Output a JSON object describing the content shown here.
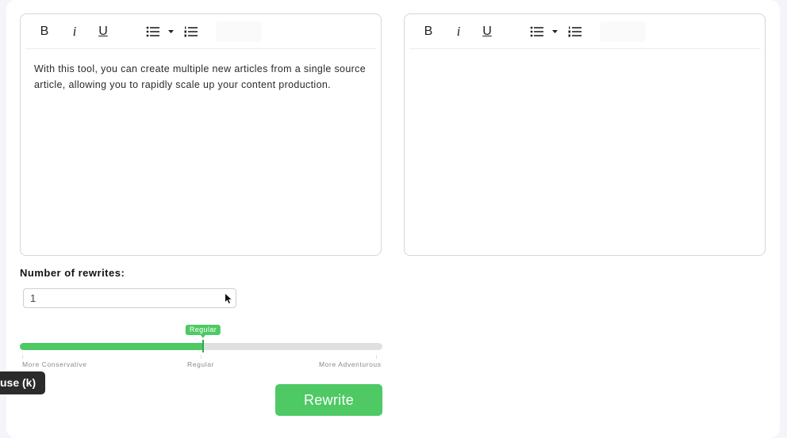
{
  "editors": {
    "source": {
      "toolbar": {
        "bold": "B",
        "italic": "i",
        "underline": "U",
        "bullet_list_icon": "bullet-list-icon",
        "dropdown_icon": "caret-down-icon",
        "ordered_list_icon": "ordered-list-icon"
      },
      "content": "With this tool, you can create multiple new articles from a single source article, allowing you to rapidly scale up your content production."
    },
    "output": {
      "toolbar": {
        "bold": "B",
        "italic": "i",
        "underline": "U",
        "bullet_list_icon": "bullet-list-icon",
        "dropdown_icon": "caret-down-icon",
        "ordered_list_icon": "ordered-list-icon"
      },
      "content": ""
    }
  },
  "rewrites": {
    "label": "Number of rewrites:",
    "selected_value": "1"
  },
  "creativity_slider": {
    "value_fraction": 0.5,
    "current_label": "Regular",
    "labels": [
      "More Conservative",
      "Regular",
      "More Adventurous"
    ]
  },
  "rewrite_button": {
    "label": "Rewrite"
  },
  "tooltip": {
    "text": "use (k)"
  },
  "colors": {
    "accent": "#4ec964",
    "track": "#dfe0e2"
  }
}
